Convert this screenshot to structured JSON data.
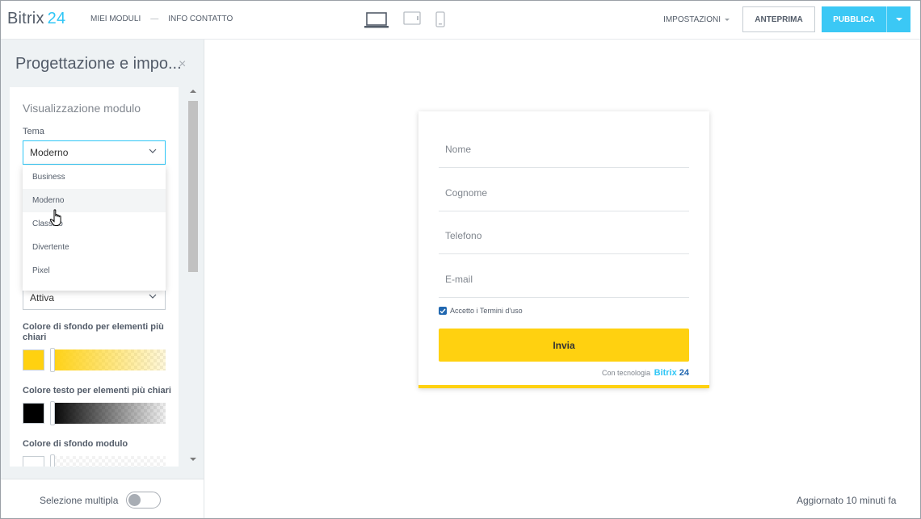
{
  "app": {
    "logo_text": "Bitrix",
    "logo_num": "24"
  },
  "nav": {
    "my_forms": "MIEI MODULI",
    "separator": "—",
    "contact_info": "INFO CONTATTO"
  },
  "devices": [
    {
      "icon": "laptop-icon",
      "active": true
    },
    {
      "icon": "tablet-icon",
      "active": false
    },
    {
      "icon": "phone-icon",
      "active": false
    }
  ],
  "toolbar": {
    "settings": "IMPOSTAZIONI",
    "preview": "ANTEPRIMA",
    "publish": "PUBBLICA"
  },
  "panel": {
    "title": "Progettazione e impo...",
    "close": "×",
    "section_title": "Visualizzazione modulo",
    "theme_label": "Tema",
    "theme_value": "Moderno",
    "theme_options": [
      "Business",
      "Moderno",
      "Classico",
      "Divertente",
      "Pixel"
    ],
    "hovered_option": "Moderno",
    "second_select_value": "Attiva",
    "light_bg_label": "Colore di sfondo per elementi più chiari",
    "light_text_label": "Colore testo per elementi più chiari",
    "form_bg_label": "Colore di sfondo modulo",
    "multi_select_label": "Selezione multipla",
    "multi_select_on": false
  },
  "colors": {
    "accent": "#ffd110",
    "brand": "#2fc6f6",
    "primary_button": "#3bc8f5",
    "text_color": "#000000",
    "form_bg": "#ffffff"
  },
  "form": {
    "fields": [
      "Nome",
      "Cognome",
      "Telefono",
      "E-mail"
    ],
    "consent_label": "Accetto i Termini d'uso",
    "consent_checked": true,
    "submit": "Invia",
    "powered_by": "Con tecnologia",
    "powered_brand": "Bitrix",
    "powered_num": "24"
  },
  "status": {
    "updated": "Aggiornato 10 minuti fa"
  }
}
